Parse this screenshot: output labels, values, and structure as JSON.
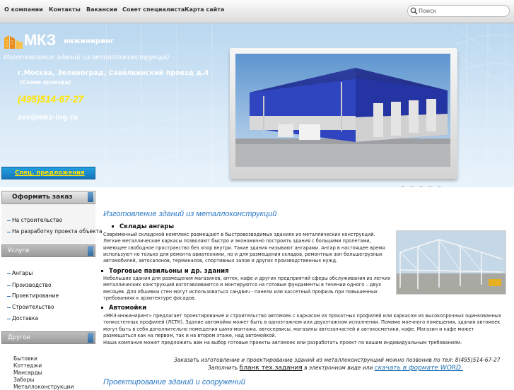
{
  "nav": {
    "items": [
      {
        "label": "О компании"
      },
      {
        "label": "Контакты"
      },
      {
        "label": "Вакансии"
      },
      {
        "label": "Совет специалиста"
      },
      {
        "label": "Карта сайта"
      }
    ],
    "search_placeholder": "Поиск"
  },
  "header": {
    "logo_main": "МКЗ",
    "logo_sub": "инжиниринг",
    "tagline": "Изготовление зданий из металлоконструкций",
    "address": "г.Москва, Зеленоград, Савёлкинский проезд д.4",
    "map_link": "(Схема проезда)",
    "phone": "(495)514-67-27",
    "email": "zov@mkz-ing.ru",
    "slide_count": 5
  },
  "sidebar": {
    "spec_tab": "Спец. предложения",
    "order_tab": "Оформить заказ",
    "order_links": [
      "На строительство",
      "На разработку проекта объекта"
    ],
    "services_tab": "Услуги",
    "services_links": [
      "Ангары",
      "Производство",
      "Проектирование",
      "Строительство",
      "Доставка"
    ],
    "other_tab": "Другое",
    "other_links": [
      "Бытовки",
      "Коттеджи",
      "Мансарды",
      "Заборы",
      "Металлоконструкции"
    ]
  },
  "content": {
    "heading": "Изготовление зданий из металлоконструкций",
    "sections": [
      {
        "title": "Склады ангары",
        "text": "Современный складской комплекс размещают в быстровозводимых зданиях из металлических конструкций. Легкие металлические каркасы позволяют быстро и экономично построить здания с большими пролетами, имеющее свободное пространство без опор внутри. Такие здания называют ангарами. Ангар в настоящее время используют не только для ремонта авиатехники, но и для размещения складов, ремонтных зон большегрузных автомобилей, автосалонов, терминалов, спортивных залов и других производственных нужд."
      },
      {
        "title": "Торговые павильоны и др. здания",
        "text": "Небольшие здания для размещения магазинов, аптек, кафе и других предприятий сферы обслуживания из легких металлических конструкций изготавливаются и монтируются на готовые фундаменты в течении одного – двух месяцев. Для обшивки стен могут использоваться сандвич - панели или кассетный профиль при повышенных требованиях к архитектуре фасадов."
      },
      {
        "title": "Автомойки",
        "text": "«МКЗ-инжиниринг» предлагает проектирование и строительство автомоек с каркасом из прокатных профилей или каркасом из высокопрочных оцинкованных тонкостенных профилей (ЛСТК). Здание автомойки может быть в одноэтажном или двухэтажном исполнении. Помимо моечного помещения, здания автомоек могут быть в себя дополнительно помещения шино-монтажа, автосервисы, магазины автозапчастей и автокосметики, кафе. Магазин и кафе может размещаться как на первом, так и на втором этаже, над автомойкой.",
        "extra": "Наша компания может предложить вам на выбор готовые проекты автомоек или разработать проект по вашим индивидуальным требованиям."
      }
    ],
    "order_line": "Заказать изготовление и проектирование зданий из металлоконструкций можно позвонив по тел: 8(495)514-67-27",
    "fill_prefix": "Заполнить ",
    "fill_link1": "бланк тех.задания",
    "fill_middle": " в электронном виде или ",
    "fill_link2": "скачать в формате WORD.",
    "bottom_heading": "Проектирование зданий и сооружений"
  },
  "colors": {
    "accent_blue": "#2a79c4",
    "phone_yellow": "#ffe400",
    "spec_tab_blue": "#1674b8"
  }
}
